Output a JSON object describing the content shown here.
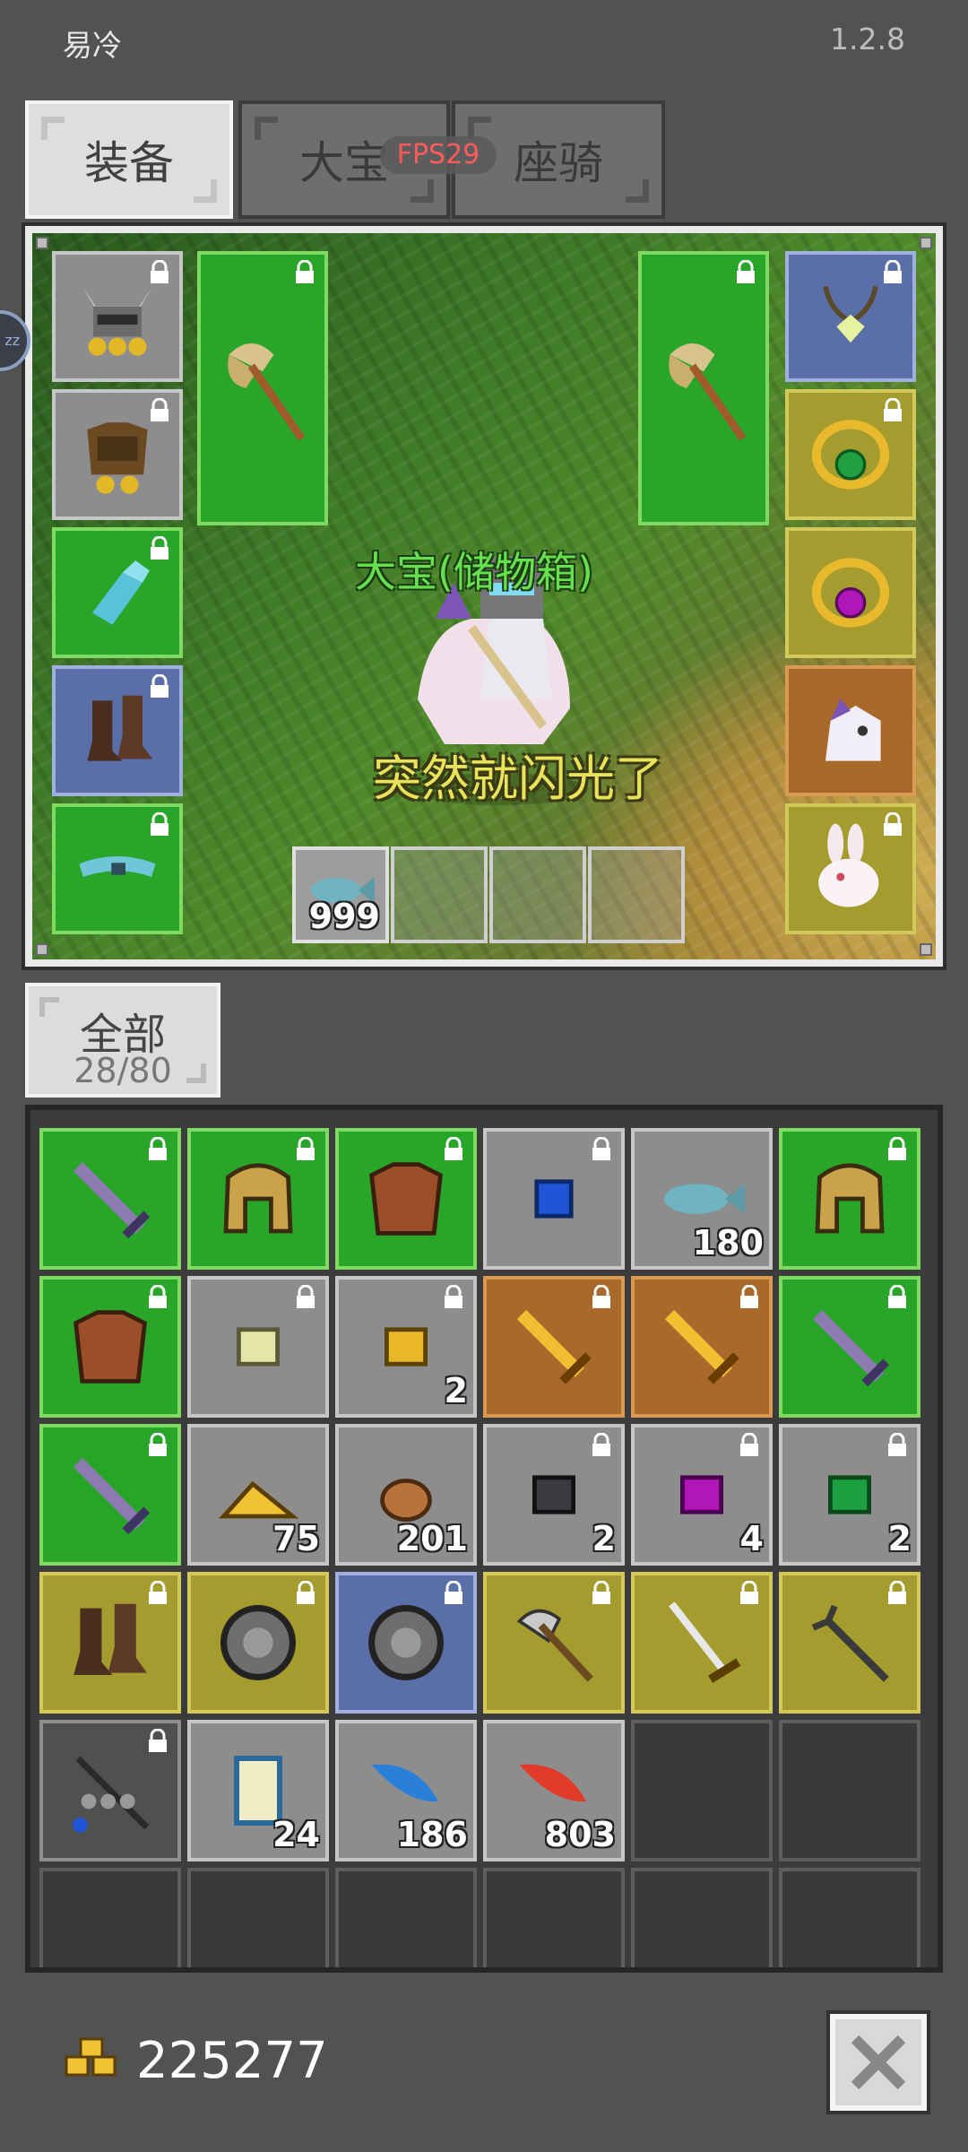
{
  "status_bar": {
    "left": "易冷",
    "right": "1.2.8"
  },
  "tabs": [
    {
      "label": "装备",
      "active": true
    },
    {
      "label": "大宝",
      "active": false
    },
    {
      "label": "座骑",
      "active": false
    }
  ],
  "fps_badge": "FPS29",
  "side_handle": "zz",
  "scene": {
    "name_label": "大宝(储物箱)",
    "speech_label": "突然就闪光了",
    "hotbar": [
      {
        "icon": "fish-icon",
        "quantity": "999"
      },
      {
        "icon": "empty-slot-icon",
        "quantity": ""
      },
      {
        "icon": "empty-slot-icon",
        "quantity": ""
      },
      {
        "icon": "empty-slot-icon",
        "quantity": ""
      }
    ],
    "equipment_left": [
      {
        "icon": "horned-helmet-icon",
        "rarity": "gray"
      },
      {
        "icon": "leather-armor-icon",
        "rarity": "gray"
      },
      {
        "icon": "blue-gauntlet-icon",
        "rarity": "green"
      },
      {
        "icon": "boots-icon",
        "rarity": "blue"
      },
      {
        "icon": "belt-icon",
        "rarity": "green"
      }
    ],
    "equipment_right": [
      {
        "icon": "antler-necklace-icon",
        "rarity": "blue"
      },
      {
        "icon": "emerald-ring-icon",
        "rarity": "olive"
      },
      {
        "icon": "amethyst-ring-icon",
        "rarity": "olive"
      },
      {
        "icon": "unicorn-mount-icon",
        "rarity": "orange"
      },
      {
        "icon": "rabbit-pet-icon",
        "rarity": "olive"
      }
    ],
    "weapon_left": {
      "icon": "double-axe-icon",
      "rarity": "green"
    },
    "weapon_right": {
      "icon": "double-axe-icon",
      "rarity": "green"
    }
  },
  "category": {
    "label": "全部",
    "count": "28/80"
  },
  "inventory": [
    [
      {
        "icon": "purple-sword-icon",
        "rarity": "green",
        "quantity": "",
        "locked": true
      },
      {
        "icon": "gold-helmet-icon",
        "rarity": "green",
        "quantity": "",
        "locked": true
      },
      {
        "icon": "chainmail-icon",
        "rarity": "green",
        "quantity": "",
        "locked": true
      },
      {
        "icon": "sapphire-gem-icon",
        "rarity": "gray",
        "quantity": "",
        "locked": true
      },
      {
        "icon": "fish-icon",
        "rarity": "gray",
        "quantity": "180",
        "locked": false
      },
      {
        "icon": "gold-helmet-icon",
        "rarity": "green",
        "quantity": "",
        "locked": true
      }
    ],
    [
      {
        "icon": "chainmail-icon",
        "rarity": "green",
        "quantity": "",
        "locked": true
      },
      {
        "icon": "pale-stone-icon",
        "rarity": "gray",
        "quantity": "",
        "locked": true
      },
      {
        "icon": "gold-stone-icon",
        "rarity": "gray",
        "quantity": "2",
        "locked": true
      },
      {
        "icon": "gold-sword-icon",
        "rarity": "orange",
        "quantity": "",
        "locked": true
      },
      {
        "icon": "gold-sword-icon",
        "rarity": "orange",
        "quantity": "",
        "locked": true
      },
      {
        "icon": "purple-sword-icon",
        "rarity": "green",
        "quantity": "",
        "locked": true
      }
    ],
    [
      {
        "icon": "purple-sword-icon",
        "rarity": "green",
        "quantity": "",
        "locked": true
      },
      {
        "icon": "gold-pile-icon",
        "rarity": "gray",
        "quantity": "75",
        "locked": false
      },
      {
        "icon": "copper-ore-icon",
        "rarity": "gray",
        "quantity": "201",
        "locked": false
      },
      {
        "icon": "dark-stone-icon",
        "rarity": "gray",
        "quantity": "2",
        "locked": true
      },
      {
        "icon": "amethyst-gem-icon",
        "rarity": "gray",
        "quantity": "4",
        "locked": true
      },
      {
        "icon": "emerald-gem-icon",
        "rarity": "gray",
        "quantity": "2",
        "locked": true
      }
    ],
    [
      {
        "icon": "boots-icon",
        "rarity": "olive",
        "quantity": "",
        "locked": true
      },
      {
        "icon": "round-shield-icon",
        "rarity": "olive",
        "quantity": "",
        "locked": true
      },
      {
        "icon": "round-shield-icon",
        "rarity": "blue",
        "quantity": "",
        "locked": true
      },
      {
        "icon": "battle-axe-icon",
        "rarity": "olive",
        "quantity": "",
        "locked": true
      },
      {
        "icon": "katana-icon",
        "rarity": "olive",
        "quantity": "",
        "locked": true
      },
      {
        "icon": "trident-icon",
        "rarity": "olive",
        "quantity": "",
        "locked": true
      }
    ],
    [
      {
        "icon": "gem-staff-icon",
        "rarity": "darkgray",
        "quantity": "",
        "locked": true
      },
      {
        "icon": "scroll-icon",
        "rarity": "gray",
        "quantity": "24",
        "locked": false
      },
      {
        "icon": "blue-feather-icon",
        "rarity": "gray",
        "quantity": "186",
        "locked": false
      },
      {
        "icon": "red-feather-icon",
        "rarity": "gray",
        "quantity": "803",
        "locked": false
      },
      {
        "icon": "empty-slot-icon",
        "rarity": "dark",
        "quantity": "",
        "locked": false
      },
      {
        "icon": "empty-slot-icon",
        "rarity": "dark",
        "quantity": "",
        "locked": false
      }
    ],
    [
      {
        "icon": "empty-slot-icon",
        "rarity": "dark",
        "quantity": "",
        "locked": false
      },
      {
        "icon": "empty-slot-icon",
        "rarity": "dark",
        "quantity": "",
        "locked": false
      },
      {
        "icon": "empty-slot-icon",
        "rarity": "dark",
        "quantity": "",
        "locked": false
      },
      {
        "icon": "empty-slot-icon",
        "rarity": "dark",
        "quantity": "",
        "locked": false
      },
      {
        "icon": "empty-slot-icon",
        "rarity": "dark",
        "quantity": "",
        "locked": false
      },
      {
        "icon": "empty-slot-icon",
        "rarity": "dark",
        "quantity": "",
        "locked": false
      }
    ]
  ],
  "footer": {
    "gold_icon": "gold-coins-icon",
    "gold_amount": "225277",
    "close_icon": "close-icon"
  },
  "colors": {
    "background": "#525252",
    "rarity_green": "#29a52a",
    "rarity_gray": "#8d8d8d",
    "rarity_blue": "#5a6fa8",
    "rarity_olive": "#a49c2e",
    "rarity_orange": "#a9692a",
    "fps_text": "#ff5a5a",
    "name_label": "#66e04e",
    "speech_label": "#e9e35b"
  }
}
